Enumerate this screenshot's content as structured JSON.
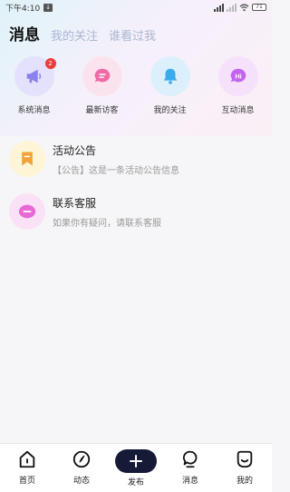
{
  "status_bar": {
    "time": "下午4:10",
    "battery": "71"
  },
  "tabs": [
    {
      "label": "消息"
    },
    {
      "label": "我的关注"
    },
    {
      "label": "谁看过我"
    }
  ],
  "quick_actions": [
    {
      "label": "系统消息",
      "icon": "megaphone-icon",
      "badge": "2",
      "bg": "#e3e1fb",
      "color": "#8a80f0"
    },
    {
      "label": "最新访客",
      "icon": "chat-bubble-icon",
      "bg": "#fbe3ee",
      "color": "#f06aa6"
    },
    {
      "label": "我的关注",
      "icon": "bell-icon",
      "bg": "#dcf0fb",
      "color": "#3cabee"
    },
    {
      "label": "互动消息",
      "icon": "hi-bubble-icon",
      "hi_text": "Hi",
      "bg": "#f5e1fb",
      "color": "#c264ee"
    }
  ],
  "message_list": [
    {
      "title": "活动公告",
      "subtitle": "【公告】这是一条活动公告信息",
      "icon": "bookmark-icon",
      "bg": "#fdf5d5",
      "color": "#f2a236"
    },
    {
      "title": "联系客服",
      "subtitle": "如果你有疑问，请联系客服",
      "icon": "customer-service-icon",
      "bg": "#fbe1f6",
      "color": "#e868d6"
    }
  ],
  "bottom_nav": [
    {
      "label": "首页",
      "icon": "home-icon"
    },
    {
      "label": "动态",
      "icon": "compass-icon"
    },
    {
      "label": "发布",
      "icon": "plus-icon"
    },
    {
      "label": "消息",
      "icon": "message-icon"
    },
    {
      "label": "我的",
      "icon": "profile-icon"
    }
  ]
}
